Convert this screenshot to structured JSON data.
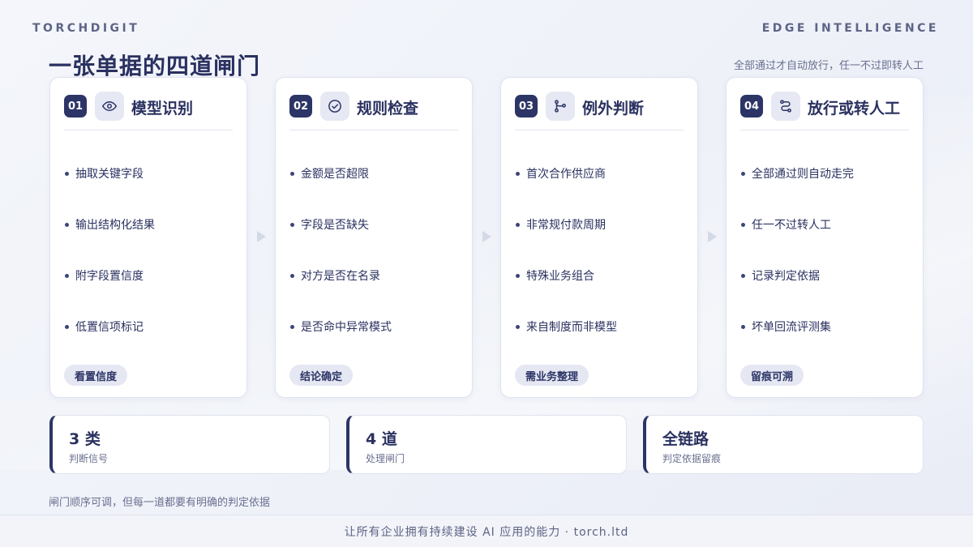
{
  "header": {
    "brand": "TORCHDIGIT",
    "tagline": "EDGE INTELLIGENCE",
    "title": "一张单据的四道闸门",
    "subtitle": "全部通过才自动放行，任一不过即转人工"
  },
  "steps": [
    {
      "number": "01",
      "icon": "eye-icon",
      "title": "模型识别",
      "bullets": [
        "抽取关键字段",
        "输出结构化结果",
        "附字段置信度",
        "低置信项标记"
      ],
      "chip": "看置信度"
    },
    {
      "number": "02",
      "icon": "check-circle-icon",
      "title": "规则检查",
      "bullets": [
        "金额是否超限",
        "字段是否缺失",
        "对方是否在名录",
        "是否命中异常模式"
      ],
      "chip": "结论确定"
    },
    {
      "number": "03",
      "icon": "branch-icon",
      "title": "例外判断",
      "bullets": [
        "首次合作供应商",
        "非常规付款周期",
        "特殊业务组合",
        "来自制度而非模型"
      ],
      "chip": "需业务整理"
    },
    {
      "number": "04",
      "icon": "route-icon",
      "title": "放行或转人工",
      "bullets": [
        "全部通过则自动走完",
        "任一不过转人工",
        "记录判定依据",
        "坏单回流评测集"
      ],
      "chip": "留痕可溯"
    }
  ],
  "stats": [
    {
      "value": "3 类",
      "label": "判断信号"
    },
    {
      "value": "4 道",
      "label": "处理闸门"
    },
    {
      "value": "全链路",
      "label": "判定依据留痕"
    }
  ],
  "footnote": "闸门顺序可调，但每一道都要有明确的判定依据",
  "footer": "让所有企业拥有持续建设 AI 应用的能力 · torch.ltd",
  "colors": {
    "primary": "#2c3566",
    "accent_bg": "#e6e8f3",
    "text_muted": "#6a7090"
  }
}
